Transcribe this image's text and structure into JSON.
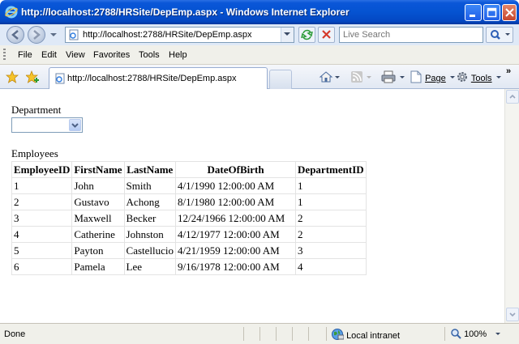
{
  "window": {
    "title": "http://localhost:2788/HRSite/DepEmp.aspx - Windows Internet Explorer",
    "address_url": "http://localhost:2788/HRSite/DepEmp.aspx",
    "search_placeholder": "Live Search",
    "tab_label": "http://localhost:2788/HRSite/DepEmp.aspx"
  },
  "menu": [
    "File",
    "Edit",
    "View",
    "Favorites",
    "Tools",
    "Help"
  ],
  "commands": {
    "page": "Page",
    "tools": "Tools"
  },
  "page": {
    "department_label": "Department",
    "department_selected": "",
    "employees_label": "Employees",
    "columns": [
      "EmployeeID",
      "FirstName",
      "LastName",
      "DateOfBirth",
      "DepartmentID"
    ],
    "rows": [
      [
        "1",
        "John",
        "Smith",
        "4/1/1990 12:00:00 AM",
        "1"
      ],
      [
        "2",
        "Gustavo",
        "Achong",
        "8/1/1980 12:00:00 AM",
        "1"
      ],
      [
        "3",
        "Maxwell",
        "Becker",
        "12/24/1966 12:00:00 AM",
        "2"
      ],
      [
        "4",
        "Catherine",
        "Johnston",
        "4/12/1977 12:00:00 AM",
        "2"
      ],
      [
        "5",
        "Payton",
        "Castellucio",
        "4/21/1959 12:00:00 AM",
        "3"
      ],
      [
        "6",
        "Pamela",
        "Lee",
        "9/16/1978 12:00:00 AM",
        "4"
      ]
    ]
  },
  "status": {
    "text": "Done",
    "zone": "Local intranet",
    "zoom": "100%"
  },
  "icons": [
    "ie-logo-icon",
    "back-icon",
    "forward-icon",
    "page-icon",
    "refresh-icon",
    "stop-icon",
    "search-icon",
    "favorites-star-icon",
    "add-favorites-icon",
    "home-icon",
    "rss-feed-icon",
    "print-icon",
    "page-menu-icon",
    "tools-gear-icon",
    "globe-icon",
    "zoom-icon"
  ],
  "colors": {
    "titlebar": "#0553d1",
    "toolbar": "#dfe9f7",
    "menubar": "#f0f0ea"
  }
}
